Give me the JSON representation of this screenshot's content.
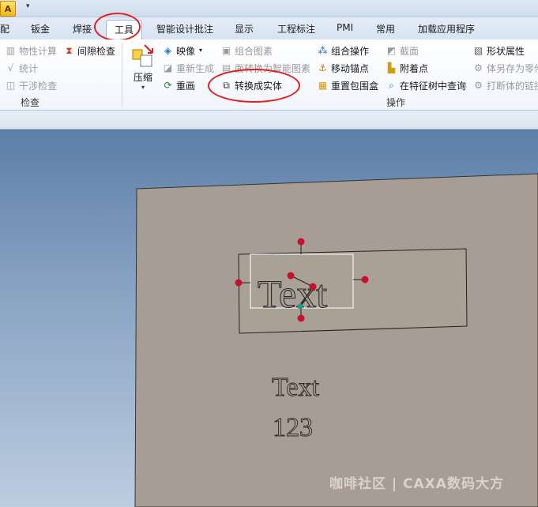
{
  "titlebar": {
    "app_icon": "caxa-app-icon",
    "qa_dropdown": "▾"
  },
  "tabs": [
    {
      "label": "配"
    },
    {
      "label": "钣金"
    },
    {
      "label": "焊接"
    },
    {
      "label": "工具",
      "active": true
    },
    {
      "label": "智能设计批注"
    },
    {
      "label": "显示"
    },
    {
      "label": "工程标注"
    },
    {
      "label": "PMI"
    },
    {
      "label": "常用"
    },
    {
      "label": "加载应用程序"
    }
  ],
  "ribbon": {
    "check_group": {
      "label": "检查",
      "items": [
        {
          "label": "物性计算",
          "icon": "mass-properties-icon",
          "disabled": true
        },
        {
          "label": "间隙检查",
          "icon": "clearance-check-icon",
          "disabled": false
        },
        {
          "label": "统计",
          "icon": "statistics-icon",
          "disabled": true
        },
        {
          "label": "干涉检查",
          "icon": "interference-check-icon",
          "disabled": true
        }
      ]
    },
    "operations_group": {
      "label": "操作",
      "compress": {
        "label": "压缩",
        "icon": "compress-icon",
        "arrow": "▾"
      },
      "col1": [
        {
          "label": "映像",
          "icon": "mirror-icon",
          "disabled": false,
          "has_dropdown": true
        },
        {
          "label": "重新生成",
          "icon": "regenerate-icon",
          "disabled": true
        },
        {
          "label": "重画",
          "icon": "redraw-icon",
          "disabled": false
        }
      ],
      "col2": [
        {
          "label": "组合图素",
          "icon": "combine-entities-icon",
          "disabled": true
        },
        {
          "label": "面转换为智能图素",
          "icon": "face-to-smart-entity-icon",
          "disabled": true
        },
        {
          "label": "转换成实体",
          "icon": "convert-to-solid-icon",
          "disabled": false
        }
      ],
      "col3": [
        {
          "label": "组合操作",
          "icon": "combine-operation-icon",
          "disabled": false
        },
        {
          "label": "移动锚点",
          "icon": "move-anchor-icon",
          "disabled": false
        },
        {
          "label": "重置包围盒",
          "icon": "reset-bounding-box-icon",
          "disabled": false
        }
      ],
      "col4": [
        {
          "label": "截面",
          "icon": "section-icon",
          "disabled": true
        },
        {
          "label": "附着点",
          "icon": "attach-point-icon",
          "disabled": false
        },
        {
          "label": "在特征树中查询",
          "icon": "find-in-tree-icon",
          "disabled": false
        }
      ],
      "col5": [
        {
          "label": "形状属性",
          "icon": "shape-properties-icon",
          "disabled": false
        },
        {
          "label": "体另存为零件",
          "icon": "save-body-as-part-icon",
          "disabled": true
        },
        {
          "label": "打断体的链接",
          "icon": "break-body-link-icon",
          "disabled": true
        }
      ]
    }
  },
  "annotations": {
    "tab_circle_color": "#e02020",
    "button_circle_color": "#e02020"
  },
  "viewport": {
    "selected_text": "Text",
    "text_line1": "Text",
    "text_line2": "123",
    "plate_color": "#a79d94",
    "handle_color": "#c8102e",
    "anchor_color": "#1aa08a",
    "watermark": "咖啡社区 | CAXA数码大方"
  }
}
